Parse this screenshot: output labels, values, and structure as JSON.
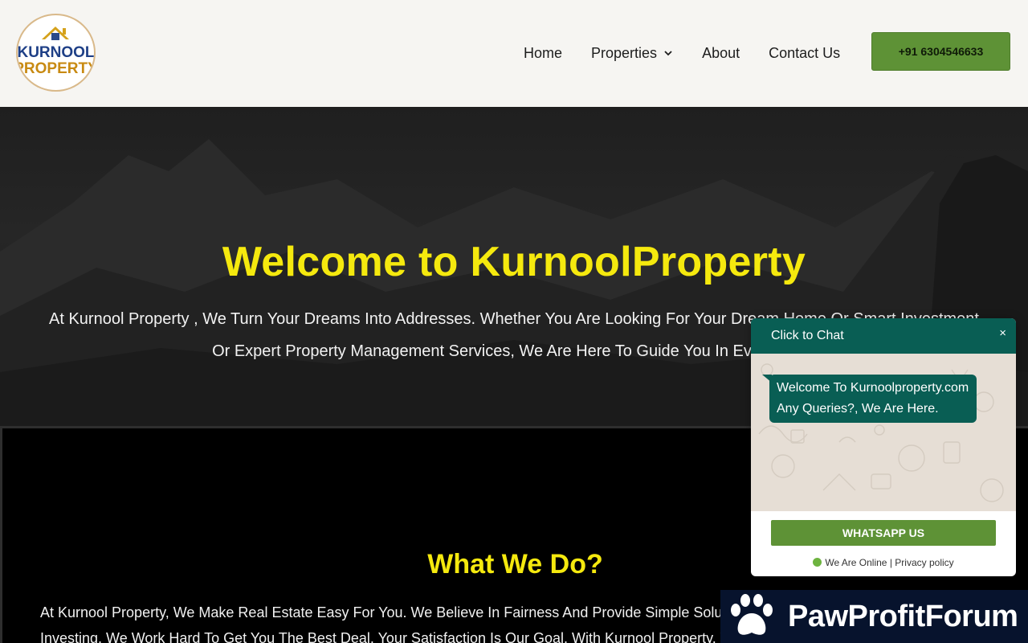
{
  "header": {
    "logo": {
      "line1": "KURNOOL",
      "line2": "PROPERTY"
    },
    "nav": [
      {
        "label": "Home"
      },
      {
        "label": "Properties"
      },
      {
        "label": "About"
      },
      {
        "label": "Contact Us"
      }
    ],
    "phone_button": "+91 6304546633"
  },
  "hero": {
    "title": "Welcome to KurnoolProperty",
    "line1": "At Kurnool Property , We Turn Your Dreams Into Addresses. Whether You Are Looking For Your Dream Home Or Smart Investment",
    "line2": "Or Expert Property Management Services, We Are Here To Guide You In Every Step."
  },
  "what_we_do": {
    "title": "What We Do?",
    "line1": "At Kurnool Property, We Make Real Estate Easy For You. We Believe In Fairness And Provide Simple Solutions For Buying, Selling, Or",
    "line2": "Investing, We Work Hard To Get You The Best Deal. Your Satisfaction Is Our Goal. With Kurnool Property, Your Dream Home Is Closer Than"
  },
  "chat_widget": {
    "header": "Click to Chat",
    "close": "×",
    "message_line1": "Welcome To Kurnoolproperty.com",
    "message_line2": "Any Queries?, We Are Here.",
    "button": "WHATSAPP US",
    "status": "We Are Online",
    "separator": "|",
    "privacy": "Privacy policy"
  },
  "banner": {
    "text": "PawProfitForum",
    "icon": "paw-icon"
  },
  "colors": {
    "accent_yellow": "#f5e90e",
    "button_green": "#5e9236",
    "chat_teal": "#095e54",
    "banner_navy": "#07132d"
  }
}
